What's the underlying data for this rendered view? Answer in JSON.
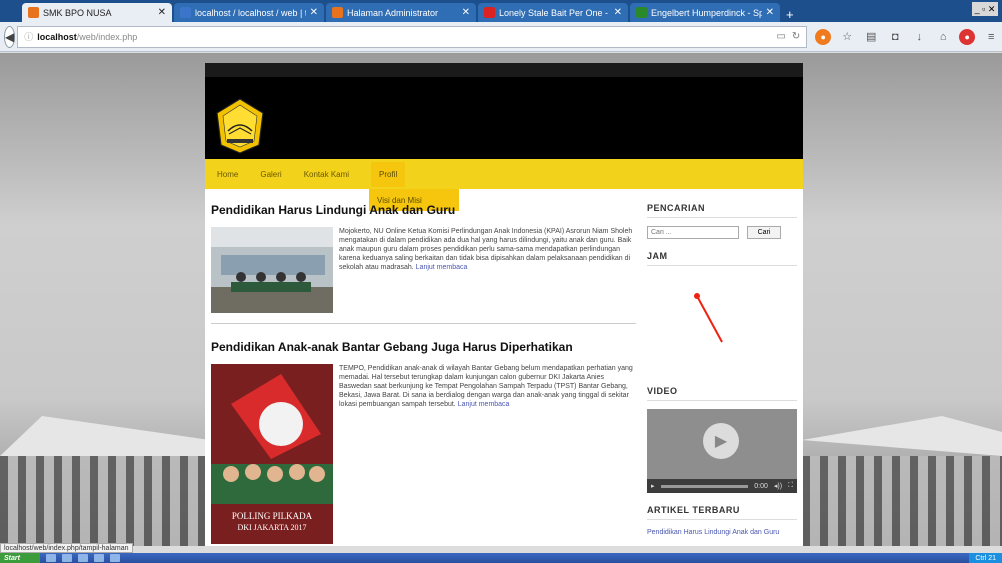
{
  "browser": {
    "tabs": [
      {
        "title": "SMK BPO NUSA",
        "favicon_color": "#e8731c",
        "active": true
      },
      {
        "title": "localhost / localhost / web | t...",
        "favicon_color": "#3b75c9",
        "active": false
      },
      {
        "title": "Halaman Administrator",
        "favicon_color": "#e8731c",
        "active": false
      },
      {
        "title": "Lonely Stale Bait Per One - E...",
        "favicon_color": "#d22",
        "active": false
      },
      {
        "title": "Engelbert Humperdinck - Spo...",
        "favicon_color": "#2a8a2a",
        "active": false
      }
    ],
    "newtab_label": "+",
    "url_host": "localhost",
    "url_path": "/web/index.php"
  },
  "site": {
    "logo_text": "SMK BPO NUSA",
    "menu": [
      "Home",
      "Galeri",
      "Kontak Kami",
      "Profil"
    ],
    "submenu_item": "Visi dan Misi",
    "posts": [
      {
        "title": "Pendidikan Harus Lindungi Anak dan Guru",
        "excerpt": "Mojokerto, NU Online Ketua Komisi Perlindungan Anak Indonesia (KPAI) Asrorun Niam Sholeh mengatakan di dalam pendidikan ada dua hal yang harus dilindungi, yaitu anak dan guru. Baik anak maupun guru dalam proses pendidikan perlu sama-sama mendapatkan perlindungan karena keduanya saling berkaitan dan tidak bisa dipisahkan dalam pelaksanaan pendidikan di sekolah atau madrasah.",
        "more": "Lanjut membaca"
      },
      {
        "title": "Pendidikan Anak-anak Bantar Gebang Juga Harus Diperhatikan",
        "excerpt": "TEMPO, Pendidikan anak-anak di wilayah Bantar Gebang belum mendapatkan perhatian yang memadai. Hal tersebut terungkap dalam kunjungan calon gubernur DKI Jakarta Anies Baswedan saat berkunjung ke Tempat Pengolahan Sampah Terpadu (TPST) Bantar Gebang, Bekasi, Jawa Barat. Di sana ia berdialog dengan warga dan anak-anak yang tinggal di sekitar lokasi pembuangan sampah tersebut.",
        "more": "Lanjut membaca",
        "poster_text_1": "POLLING PILKADA",
        "poster_text_2": "DKI JAKARTA 2017"
      }
    ],
    "sidebar": {
      "search_title": "PENCARIAN",
      "search_placeholder": "Cari ...",
      "search_button": "Cari",
      "clock_title": "JAM",
      "video_title": "VIDEO",
      "video_time": "0:00",
      "latest_title": "ARTIKEL TERBARU",
      "latest_link": "Pendidikan Harus Lindungi Anak dan Guru"
    }
  },
  "status": {
    "hover_url": "localhost/web/index.php/tampil-halaman"
  },
  "taskbar": {
    "start_label": "Start",
    "clock": "Ctrl 21"
  }
}
